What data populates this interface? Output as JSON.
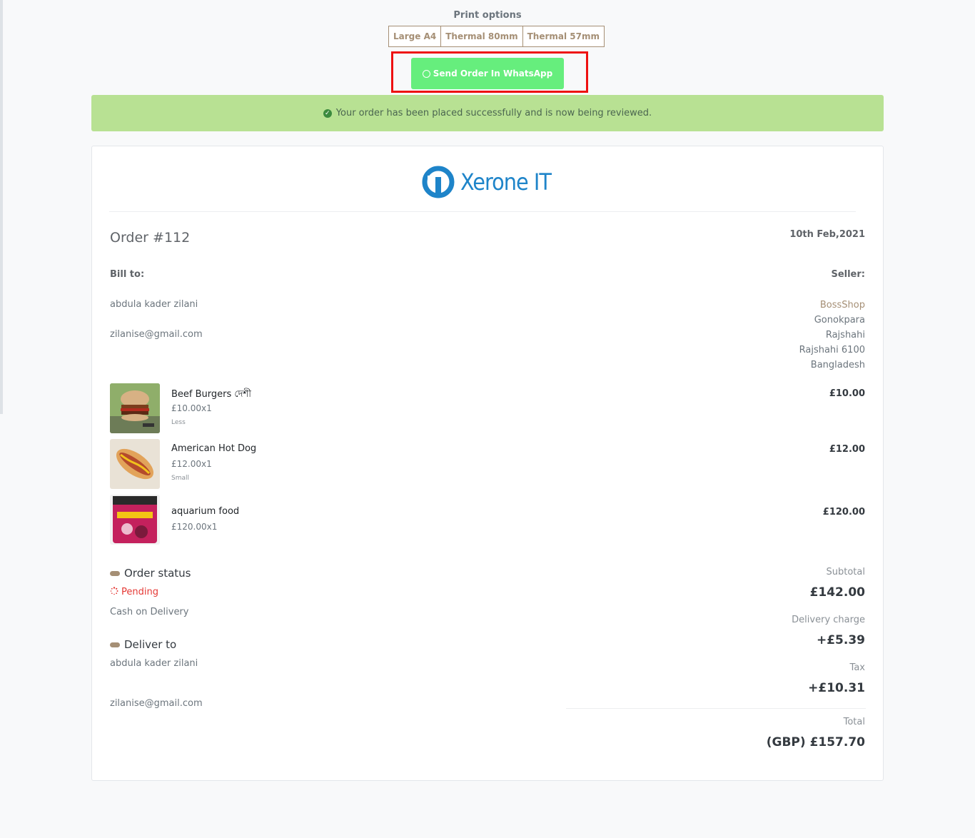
{
  "print": {
    "title": "Print options",
    "options": [
      "Large A4",
      "Thermal 80mm",
      "Thermal 57mm"
    ]
  },
  "whatsapp": {
    "label": "Send Order In WhatsApp",
    "color": "#66ee7d"
  },
  "alert": {
    "message": "Your order has been placed successfully and is now being reviewed.",
    "color": "#b8e193"
  },
  "brand": {
    "name": "Xerone IT",
    "color": "#1e84c9"
  },
  "order": {
    "title": "Order #112",
    "date": "10th Feb,2021"
  },
  "bill_to": {
    "label": "Bill to:",
    "name": "abdula kader zilani",
    "email": "zilanise@gmail.com"
  },
  "seller": {
    "label": "Seller:",
    "name": "BossShop",
    "address": [
      "Gonokpara",
      "Rajshahi",
      "Rajshahi 6100",
      "Bangladesh"
    ]
  },
  "items": [
    {
      "name": "Beef Burgers দেশী",
      "price": "£10.00x1",
      "note": "Less",
      "total": "£10.00",
      "icon": "burger-image"
    },
    {
      "name": "American Hot Dog",
      "price": "£12.00x1",
      "note": "Small",
      "total": "£12.00",
      "icon": "hotdog-image"
    },
    {
      "name": "aquarium food",
      "price": "£120.00x1",
      "note": "",
      "total": "£120.00",
      "icon": "fish-food-image"
    }
  ],
  "status": {
    "heading": "Order status",
    "state": "Pending",
    "payment": "Cash on Delivery"
  },
  "deliver": {
    "heading": "Deliver to",
    "name": "abdula kader zilani",
    "email": "zilanise@gmail.com"
  },
  "summary": {
    "subtotal_label": "Subtotal",
    "subtotal": "£142.00",
    "delivery_label": "Delivery charge",
    "delivery": "+£5.39",
    "tax_label": "Tax",
    "tax": "+£10.31",
    "total_label": "Total",
    "total": "(GBP) £157.70"
  },
  "colors": {
    "accent": "#a58f75",
    "highlight": "#ee1111",
    "pending": "#e53935"
  }
}
